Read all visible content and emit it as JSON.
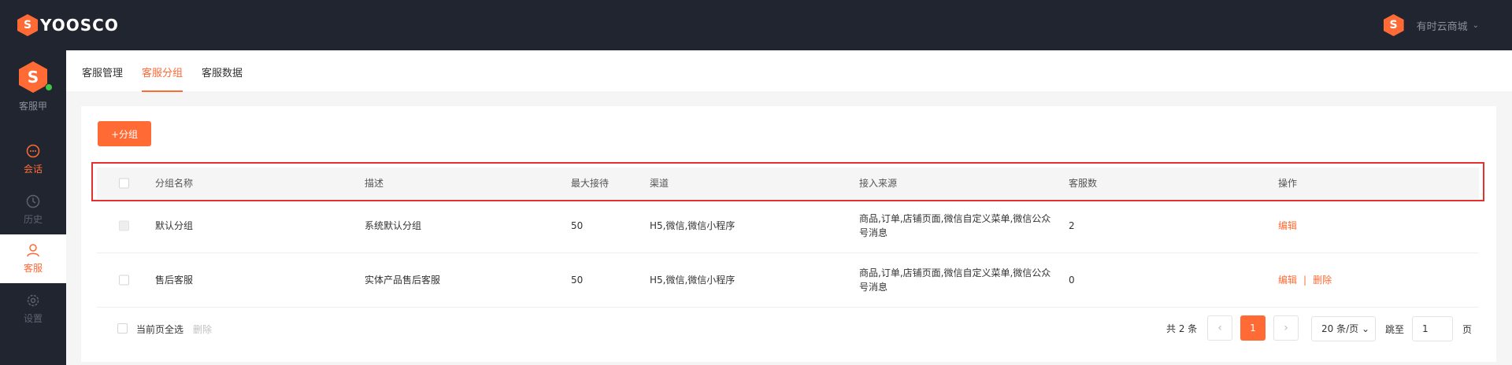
{
  "brand": {
    "logo_letter": "S",
    "name": "YOOSCO"
  },
  "top_right": {
    "shop_name": "有时云商城"
  },
  "agent": {
    "name": "客服甲",
    "status_color": "#3ec646"
  },
  "nav": [
    {
      "label": "会话",
      "icon": "chat-icon"
    },
    {
      "label": "历史",
      "icon": "clock-icon"
    },
    {
      "label": "客服",
      "icon": "user-icon"
    },
    {
      "label": "设置",
      "icon": "gear-icon"
    }
  ],
  "tabs": [
    {
      "label": "客服管理"
    },
    {
      "label": "客服分组"
    },
    {
      "label": "客服数据"
    }
  ],
  "add_button": "+分组",
  "table": {
    "headers": [
      "分组名称",
      "描述",
      "最大接待",
      "渠道",
      "接入来源",
      "客服数",
      "操作"
    ],
    "rows": [
      {
        "name": "默认分组",
        "desc": "系统默认分组",
        "max": "50",
        "channel": "H5,微信,微信小程序",
        "source_line1": "商品,订单,店铺页面,微信自定义菜单,微信公众",
        "source_line2": "号消息",
        "count": "2",
        "edit": "编辑"
      },
      {
        "name": "售后客服",
        "desc": "实体产品售后客服",
        "max": "50",
        "channel": "H5,微信,微信小程序",
        "source_line1": "商品,订单,店铺页面,微信自定义菜单,微信公众",
        "source_line2": "号消息",
        "count": "0",
        "edit": "编辑",
        "separator": "|",
        "delete": "删除"
      }
    ]
  },
  "footer": {
    "select_all": "当前页全选",
    "delete": "删除",
    "total": "共 2 条",
    "prev": "‹",
    "page": "1",
    "next": "›",
    "page_size": "20 条/页",
    "jump_label": "跳至",
    "jump_value": "1",
    "page_unit": "页"
  },
  "colors": {
    "accent": "#ff6a35",
    "dark": "#212530",
    "highlight_box": "#e53030"
  }
}
